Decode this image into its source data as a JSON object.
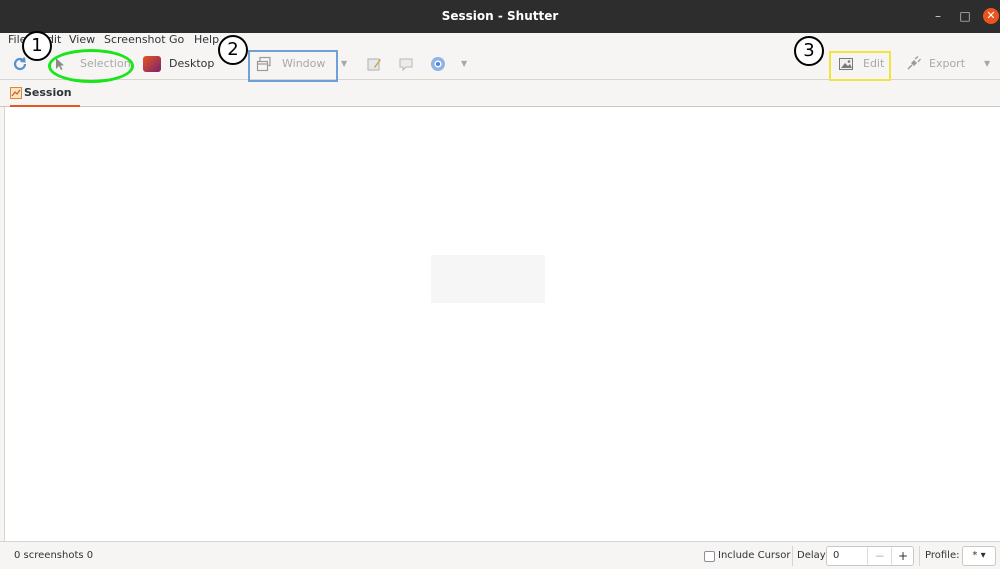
{
  "window": {
    "title": "Session - Shutter",
    "controls": {
      "minimize": "–",
      "maximize": "□",
      "close": "✕"
    }
  },
  "menubar": {
    "items": [
      "File",
      "Edit",
      "View",
      "Screenshot",
      "Go",
      "Help"
    ]
  },
  "toolbar": {
    "refresh_icon": "refresh-icon",
    "selection_label": "Selection",
    "desktop_label": "Desktop",
    "window_label": "Window",
    "edit_label": "Edit",
    "export_label": "Export"
  },
  "tabs": [
    {
      "label": "Session"
    }
  ],
  "statusbar": {
    "screenshots_count": "0 screenshots 0",
    "include_cursor_label": "Include Cursor",
    "delay_label": "Delay:",
    "delay_value": "0",
    "profile_label": "Profile:",
    "profile_value": "* ▾"
  },
  "annotations": {
    "markers": [
      "1",
      "2",
      "3"
    ],
    "colors": {
      "ellipse": "#19e619",
      "rect_blue": "#6fa0d8",
      "rect_yellow": "#f0e442"
    }
  },
  "colors": {
    "accent": "#e95420",
    "titlebar": "#2d2d2d"
  }
}
